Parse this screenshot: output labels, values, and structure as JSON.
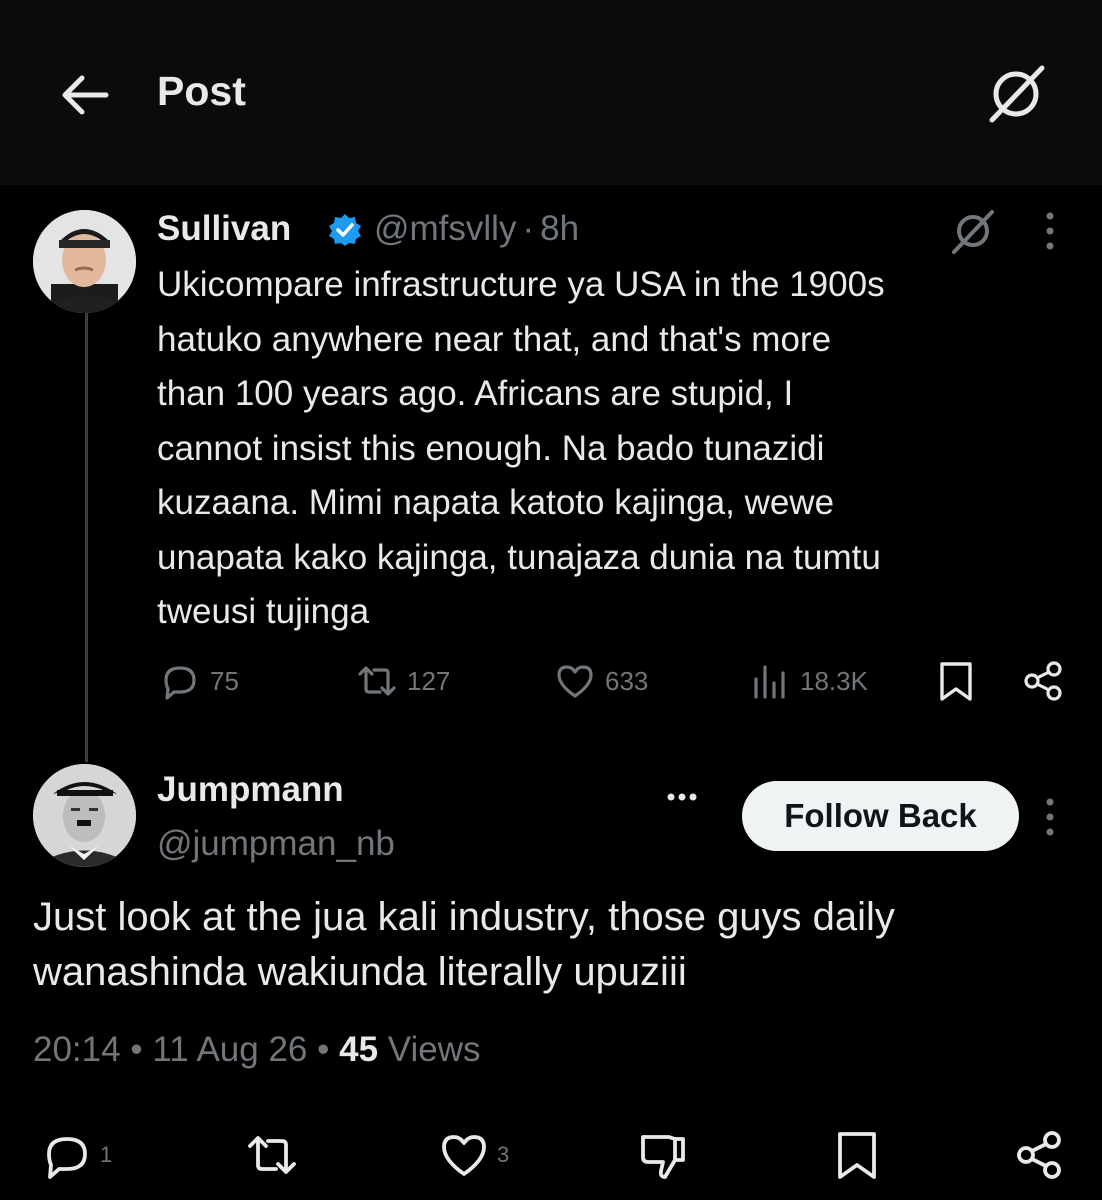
{
  "header": {
    "title": "Post",
    "back_icon": "arrow-left-icon",
    "grok_icon": "grok-icon"
  },
  "tweet": {
    "author_name": "Sullivan",
    "verified": true,
    "handle": "@mfsvlly",
    "separator": "·",
    "time": "8h",
    "text": "Ukicompare infrastructure ya USA in the 1900s\nhatuko anywhere near that, and that's more\nthan 100 years ago. Africans are stupid, I\ncannot insist this enough. Na bado tunazidi\nkuzaana. Mimi napata katoto kajinga, wewe\nunapata kako kajinga, tunajaza dunia na tumtu\ntweusi tujinga",
    "stats": {
      "replies": "75",
      "reposts": "127",
      "likes": "633",
      "views": "18.3K"
    }
  },
  "reply": {
    "author_name": "Jumpmann",
    "handle": "@jumpman_nb",
    "follow_label": "Follow Back",
    "text": "Just look at the jua kali industry, those guys daily\nwanashinda wakiunda literally upuziii",
    "time": "20:14",
    "dot1": "•",
    "date": "11 Aug 26",
    "dot2": "•",
    "views_count": "45",
    "views_label": "Views",
    "stats": {
      "replies": "1",
      "likes": "3"
    }
  },
  "colors": {
    "background": "#000000",
    "text": "#e7e9ea",
    "muted": "#71767b",
    "verified": "#1d9bf0"
  }
}
